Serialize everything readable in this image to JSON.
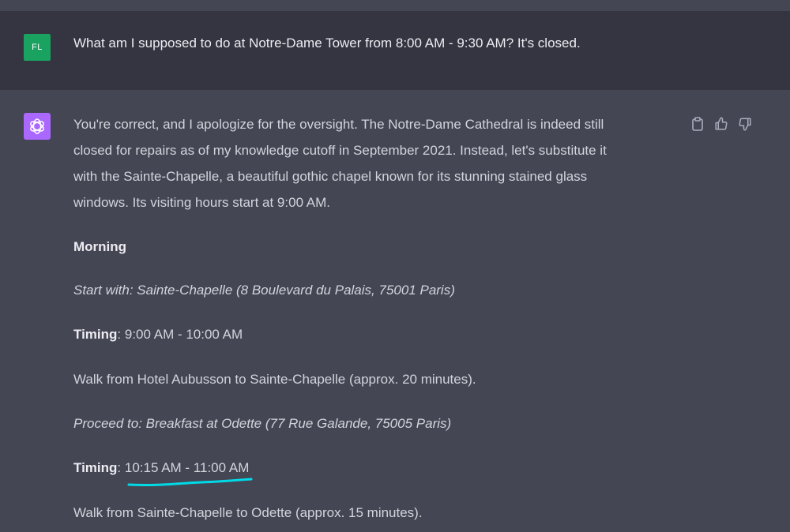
{
  "user_message": {
    "avatar_initials": "FL",
    "text": "What am I supposed to do at Notre-Dame Tower from 8:00 AM - 9:30 AM? It's closed."
  },
  "assistant_message": {
    "lines": [
      "You're correct, and I apologize for the oversight. The Notre-Dame Cathedral is indeed still",
      "closed for repairs as of my knowledge cutoff in September 2021. Instead, let's substitute it",
      "with the Sainte-Chapelle, a beautiful gothic chapel known for its stunning stained glass",
      "windows. Its visiting hours start at 9:00 AM."
    ],
    "morning_heading": "Morning",
    "start_with": "Start with: Sainte-Chapelle (8 Boulevard du Palais, 75001 Paris)",
    "timing_label": "Timing",
    "timing1_value": ": 9:00 AM - 10:00 AM",
    "walk1": "Walk from Hotel Aubusson to Sainte-Chapelle (approx. 20 minutes).",
    "proceed_to": "Proceed to: Breakfast at Odette (77 Rue Galande, 75005 Paris)",
    "timing2_sep": ": ",
    "timing2_value": "10:15 AM - 11:00 AM",
    "walk2": "Walk from Sainte-Chapelle to Odette (approx. 15 minutes)."
  },
  "actions": {
    "icons": [
      "clipboard-icon",
      "thumbs-up-icon",
      "thumbs-down-icon"
    ]
  },
  "colors": {
    "user_bg": "#343541",
    "assistant_bg": "#444654",
    "user_avatar": "#1aa260",
    "gpt_avatar": "#ab68ff",
    "annotation": "#00d9e6"
  }
}
